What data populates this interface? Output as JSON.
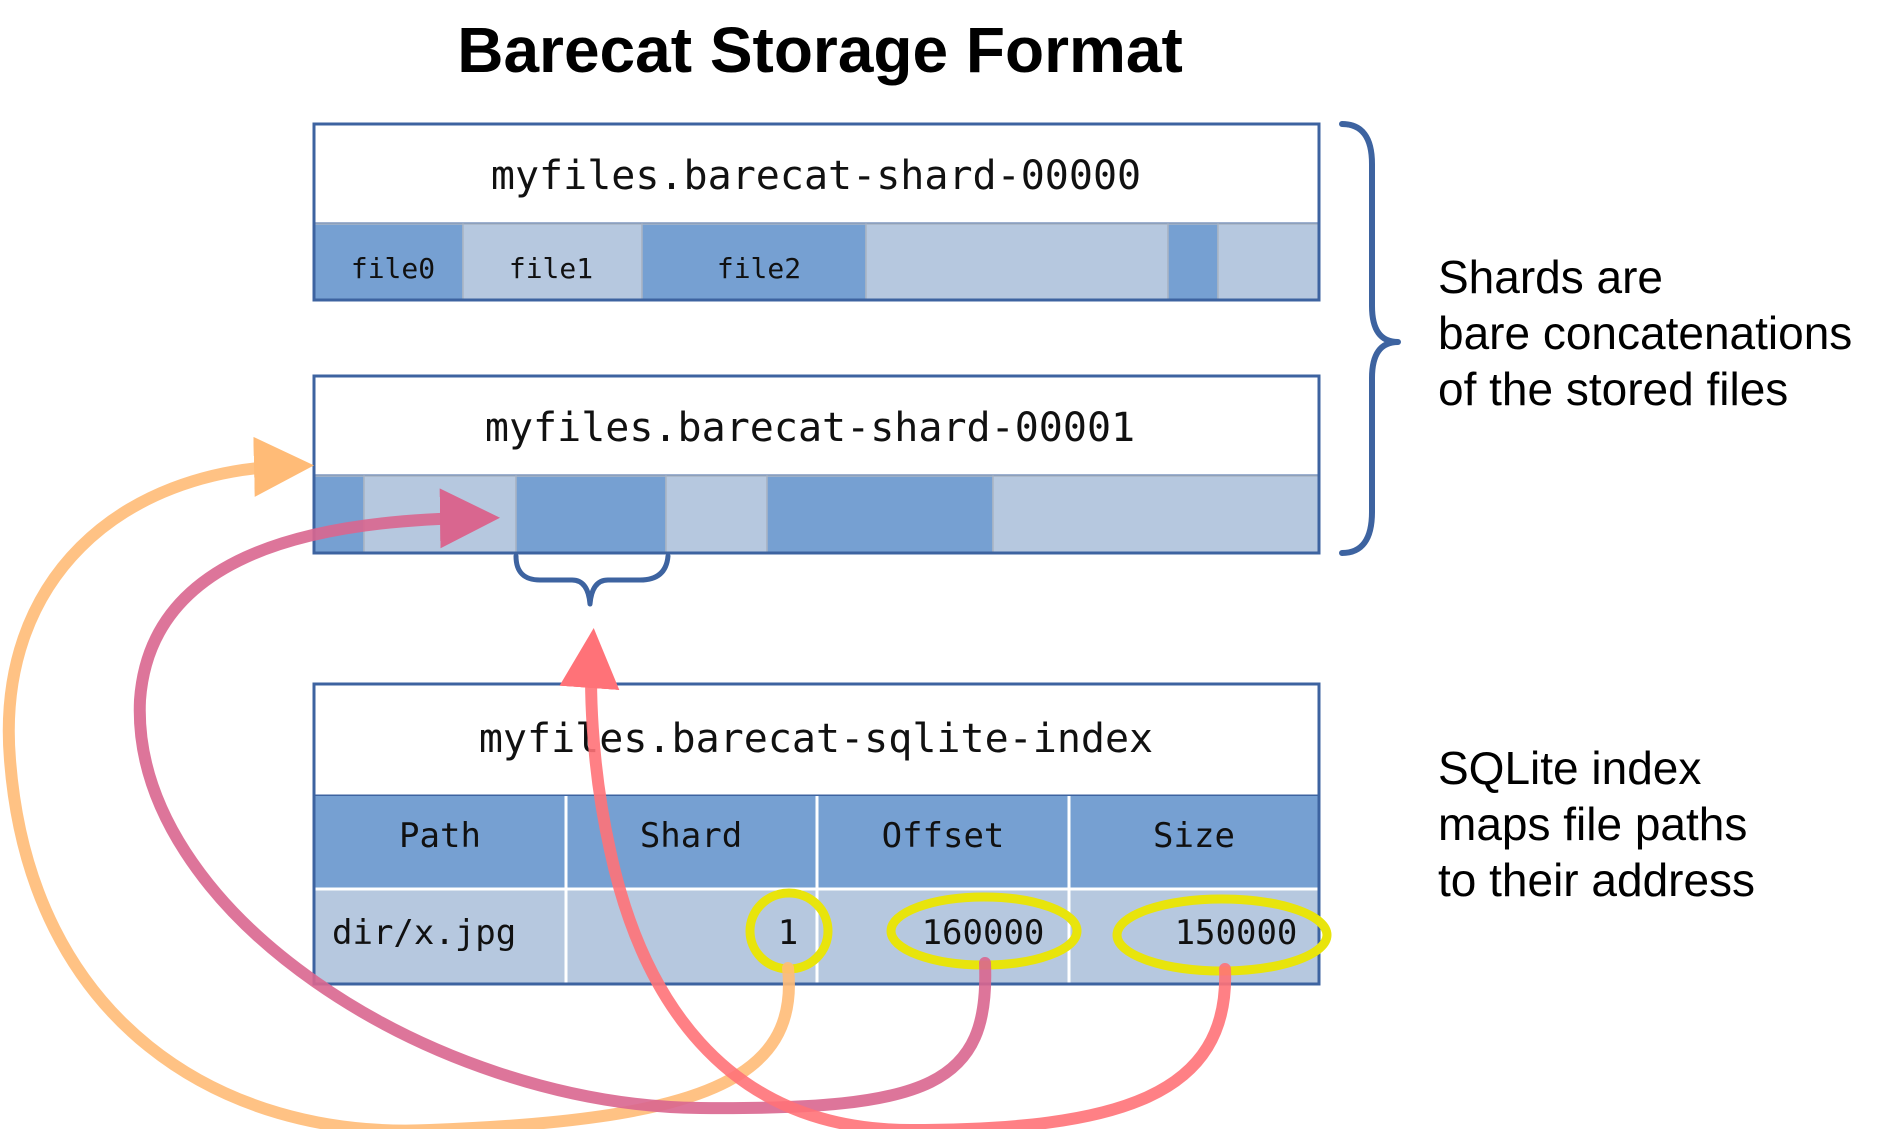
{
  "title": "Barecat Storage Format",
  "colors": {
    "border": "#3d63a0",
    "segment_dark": "#76a0d2",
    "segment_light": "#b6c8df",
    "table_header": "#76a0d2",
    "table_row": "#b6c8df",
    "highlight": "#e8e40c",
    "arrow_orange": "#ffbb77",
    "arrow_mauve": "#d9668f",
    "arrow_red": "#ff7278"
  },
  "shards": [
    {
      "name": "myfiles.barecat-shard-00000",
      "segments": [
        {
          "label": "file0",
          "shade": "dark"
        },
        {
          "label": "file1",
          "shade": "light"
        },
        {
          "label": "file2",
          "shade": "dark"
        },
        {
          "label": "",
          "shade": "light"
        },
        {
          "label": "",
          "shade": "dark"
        },
        {
          "label": "",
          "shade": "light"
        }
      ]
    },
    {
      "name": "myfiles.barecat-shard-00001",
      "segments": [
        {
          "label": "",
          "shade": "dark"
        },
        {
          "label": "",
          "shade": "light"
        },
        {
          "label": "",
          "shade": "dark"
        },
        {
          "label": "",
          "shade": "light"
        },
        {
          "label": "",
          "shade": "dark"
        },
        {
          "label": "",
          "shade": "light"
        }
      ]
    }
  ],
  "index": {
    "name": "myfiles.barecat-sqlite-index",
    "columns": [
      "Path",
      "Shard",
      "Offset",
      "Size"
    ],
    "row": {
      "path": "dir/x.jpg",
      "shard": "1",
      "offset": "160000",
      "size": "150000"
    }
  },
  "notes": {
    "shards_lines": [
      "Shards are",
      "bare concatenations",
      "of the stored files"
    ],
    "index_lines": [
      "SQLite index",
      "maps file paths",
      "to their address"
    ]
  }
}
